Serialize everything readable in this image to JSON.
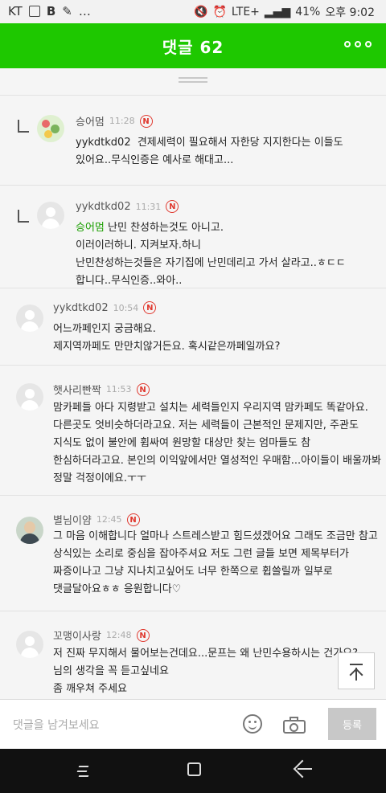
{
  "status_bar": {
    "carrier": "KT",
    "signal_label": "LTE+",
    "battery": "41%",
    "time": "오후 9:02"
  },
  "header": {
    "title": "댓글 62",
    "more_icon": "more-dots-icon"
  },
  "comments": [
    {
      "nickname": "승어멈",
      "time": "11:28",
      "badge": "N",
      "is_reply": true,
      "avatar": "flower",
      "mention": "",
      "text": "yykdtkd02  견제세력이 필요해서 자한당 지지한다는 이들도\n있어요..무식인증은 예사로 해대고..."
    },
    {
      "nickname": "yykdtkd02",
      "time": "11:31",
      "badge": "N",
      "is_reply": true,
      "avatar": "default",
      "mention": "승어멈",
      "text": " 난민 찬성하는것도 아니고.\n이러이러하니. 지켜보자.하니\n난민찬성하는것들은 자기집에 난민데리고 가서 살라고..ㅎㄷㄷ\n합니다..무식인증..와아.."
    },
    {
      "nickname": "yykdtkd02",
      "time": "10:54",
      "badge": "N",
      "is_reply": false,
      "avatar": "default",
      "mention": "",
      "text": "어느까페인지 궁금해요.\n제지역까페도 만만치않거든요. 혹시같은까페일까요?"
    },
    {
      "nickname": "햇사리빤짝",
      "time": "11:53",
      "badge": "N",
      "is_reply": false,
      "avatar": "default",
      "mention": "",
      "text": "맘카페들 아다 지령받고 설치는 세력들인지 우리지역 맘카페도 똑같아요.\n다른곳도 엇비슷하더라고요. 저는 세력들이 근본적인 문제지만, 주관도\n지식도 없이 불안에 휩싸여 원망할 대상만 찾는 엄마들도 참\n한심하더라고요. 본인의 이익앞에서만 열성적인 우매함...아이들이 배울까봐\n정말 걱정이에요.ㅜㅜ"
    },
    {
      "nickname": "별님이얌",
      "time": "12:45",
      "badge": "N",
      "is_reply": false,
      "avatar": "person",
      "mention": "",
      "text": "그 마음 이해합니다 얼마나 스트레스받고 힘드셨겠어요 그래도 조금만 참고\n상식있는 소리로 중심을 잡아주셔요 저도 그런 글들 보면 제목부터가\n짜증이나고 그냥 지나치고싶어도 너무 한쪽으로 휩쓸릴까 일부로\n댓글달아요ㅎㅎ 응원합니다♡"
    },
    {
      "nickname": "꼬맹이사랑",
      "time": "12:48",
      "badge": "N",
      "is_reply": false,
      "avatar": "default",
      "mention": "",
      "text": "저 진짜 무지해서 물어보는건데요...문프는 왜 난민수용하시는 건가요?\n님의 생각을 꼭 듣고싶네요\n좀 깨우쳐 주세요"
    }
  ],
  "input_bar": {
    "placeholder": "댓글을 남겨보세요",
    "submit_label": "등록"
  },
  "colors": {
    "header_green": "#1ec800",
    "badge_red": "#e0392f"
  }
}
